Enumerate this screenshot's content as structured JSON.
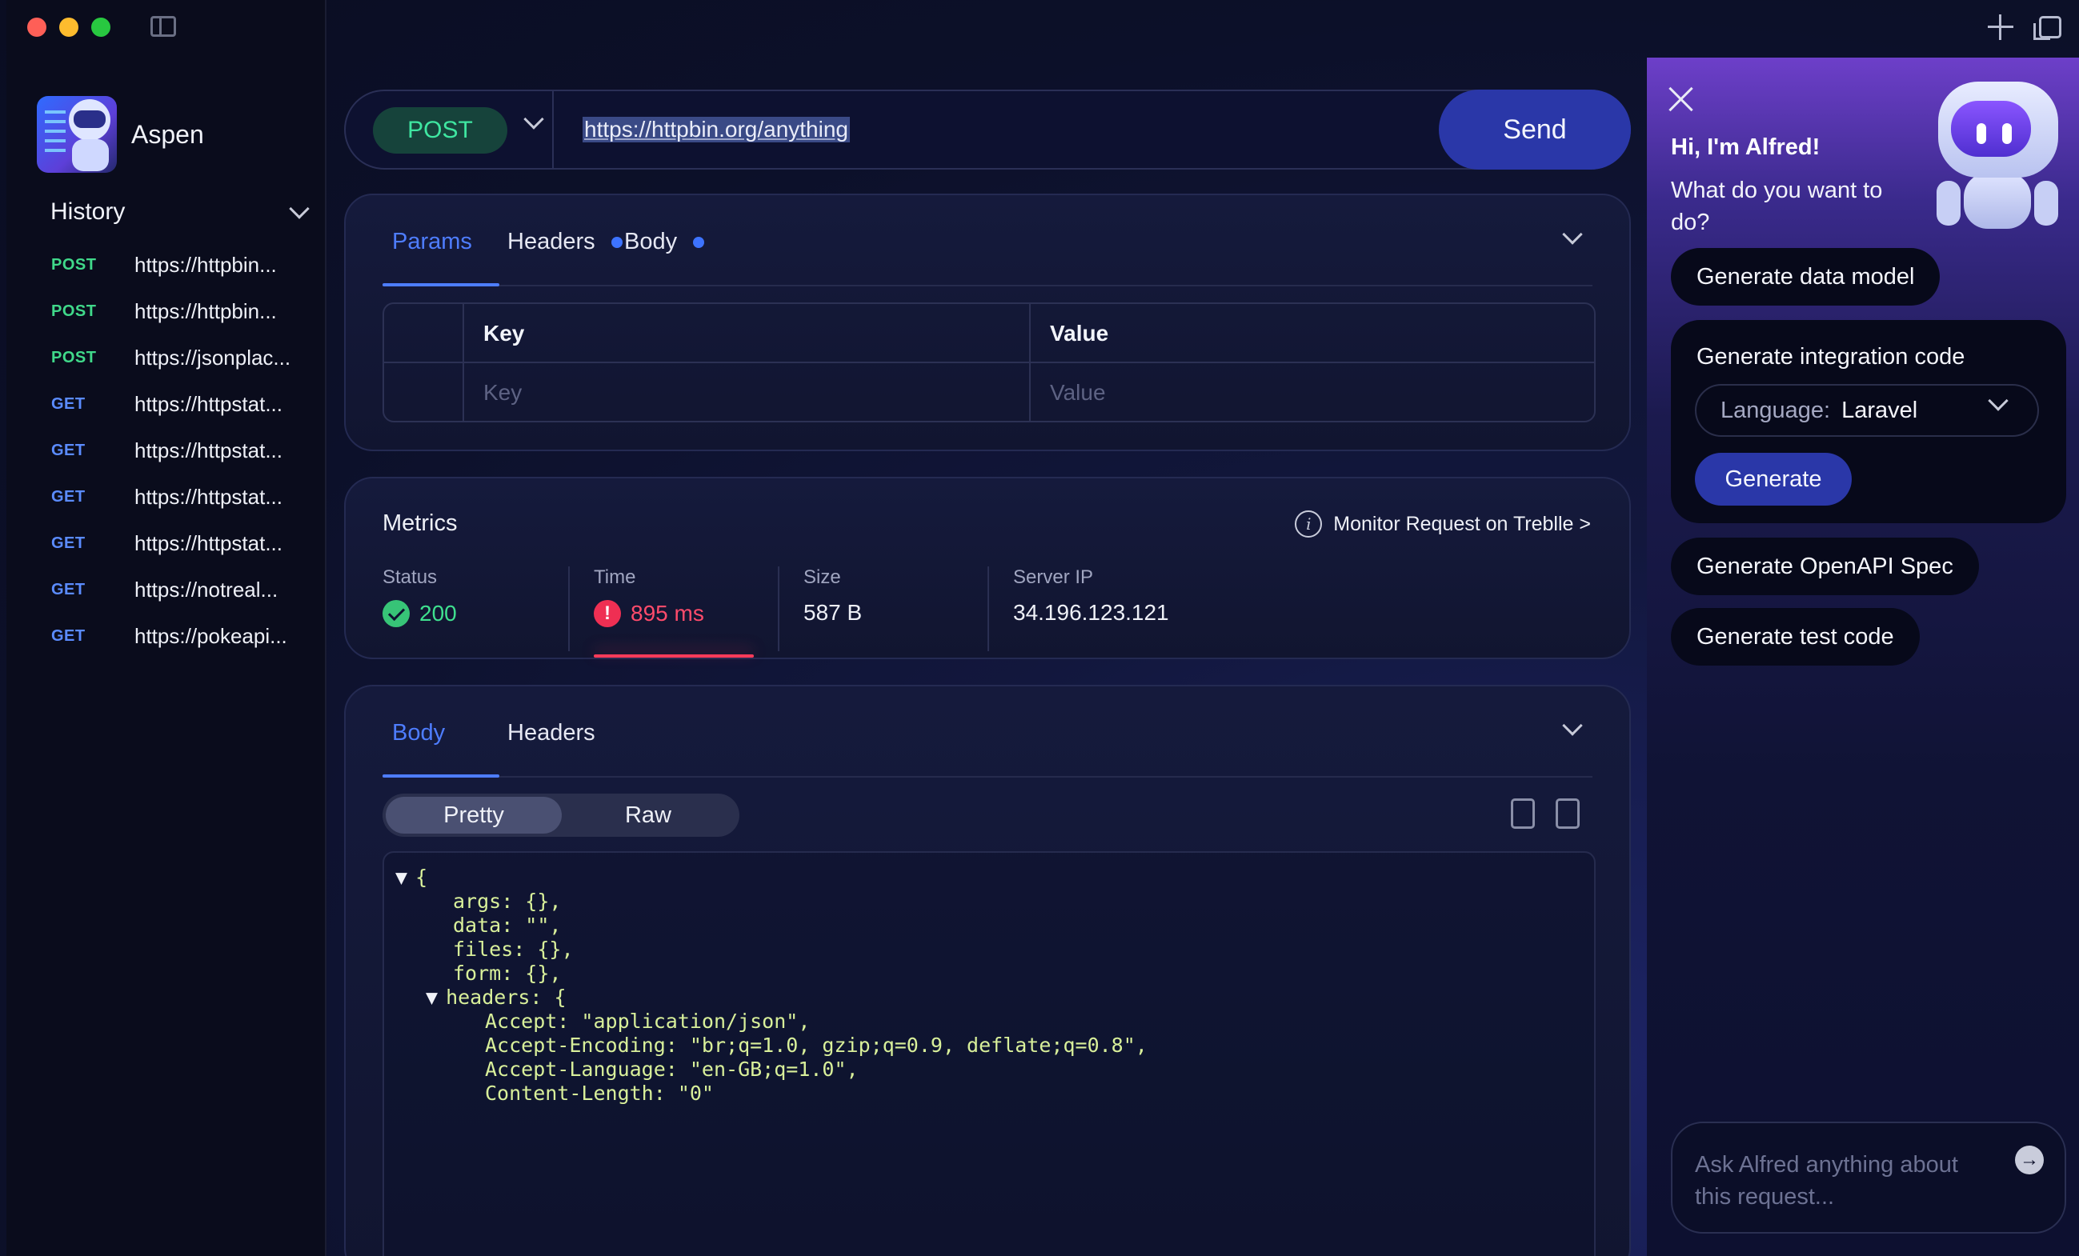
{
  "app": {
    "name": "Aspen"
  },
  "history": {
    "title": "History",
    "items": [
      {
        "method": "POST",
        "url": "https://httpbin..."
      },
      {
        "method": "POST",
        "url": "https://httpbin..."
      },
      {
        "method": "POST",
        "url": "https://jsonplac..."
      },
      {
        "method": "GET",
        "url": "https://httpstat..."
      },
      {
        "method": "GET",
        "url": "https://httpstat..."
      },
      {
        "method": "GET",
        "url": "https://httpstat..."
      },
      {
        "method": "GET",
        "url": "https://httpstat..."
      },
      {
        "method": "GET",
        "url": "https://notreal..."
      },
      {
        "method": "GET",
        "url": "https://pokeapi..."
      }
    ]
  },
  "request": {
    "method": "POST",
    "url": "https://httpbin.org/anything",
    "send_label": "Send",
    "tabs": {
      "params": "Params",
      "headers": "Headers",
      "body": "Body"
    },
    "params_table": {
      "key_header": "Key",
      "value_header": "Value",
      "key_placeholder": "Key",
      "value_placeholder": "Value"
    }
  },
  "metrics": {
    "title": "Metrics",
    "monitor_link": "Monitor Request on Treblle >",
    "status_label": "Status",
    "status_value": "200",
    "time_label": "Time",
    "time_value": "895 ms",
    "size_label": "Size",
    "size_value": "587 B",
    "server_ip_label": "Server IP",
    "server_ip_value": "34.196.123.121"
  },
  "response": {
    "tabs": {
      "body": "Body",
      "headers": "Headers"
    },
    "view_modes": {
      "pretty": "Pretty",
      "raw": "Raw"
    },
    "code_lines": [
      {
        "indent": 0,
        "toggle": "▼",
        "text": "{"
      },
      {
        "indent": 1,
        "toggle": "",
        "text": "args: {},"
      },
      {
        "indent": 1,
        "toggle": "",
        "text": "data: \"\","
      },
      {
        "indent": 1,
        "toggle": "",
        "text": "files: {},"
      },
      {
        "indent": 1,
        "toggle": "",
        "text": "form: {},"
      },
      {
        "indent": 1,
        "toggle": "▼",
        "text": "headers: {"
      },
      {
        "indent": 2,
        "toggle": "",
        "text": "Accept: \"application/json\","
      },
      {
        "indent": 2,
        "toggle": "",
        "text": "Accept-Encoding: \"br;q=1.0, gzip;q=0.9, deflate;q=0.8\","
      },
      {
        "indent": 2,
        "toggle": "",
        "text": "Accept-Language: \"en-GB;q=1.0\","
      },
      {
        "indent": 2,
        "toggle": "",
        "text": "Content-Length: \"0\""
      }
    ]
  },
  "assistant": {
    "greeting": "Hi, I'm Alfred!",
    "question": "What do you want to do?",
    "actions": {
      "data_model": "Generate data model",
      "integration_code": "Generate integration code",
      "openapi": "Generate OpenAPI Spec",
      "test_code": "Generate test code"
    },
    "language_label": "Language:",
    "language_value": "Laravel",
    "generate_label": "Generate",
    "ask_placeholder": "Ask Alfred anything about this request..."
  },
  "icons": {
    "close": "close-icon",
    "plus": "plus-icon",
    "windows": "windows-icon",
    "copy": "copy-icon",
    "download": "download-icon",
    "info": "info-icon",
    "status_ok": "check-circle-icon",
    "time_warn": "exclamation-circle-icon"
  },
  "colors": {
    "accent": "#4e7dff",
    "post": "#40d98a",
    "get": "#5b8cff",
    "error": "#ff4b6b",
    "success": "#3fe08f",
    "send": "#2a37a8"
  }
}
